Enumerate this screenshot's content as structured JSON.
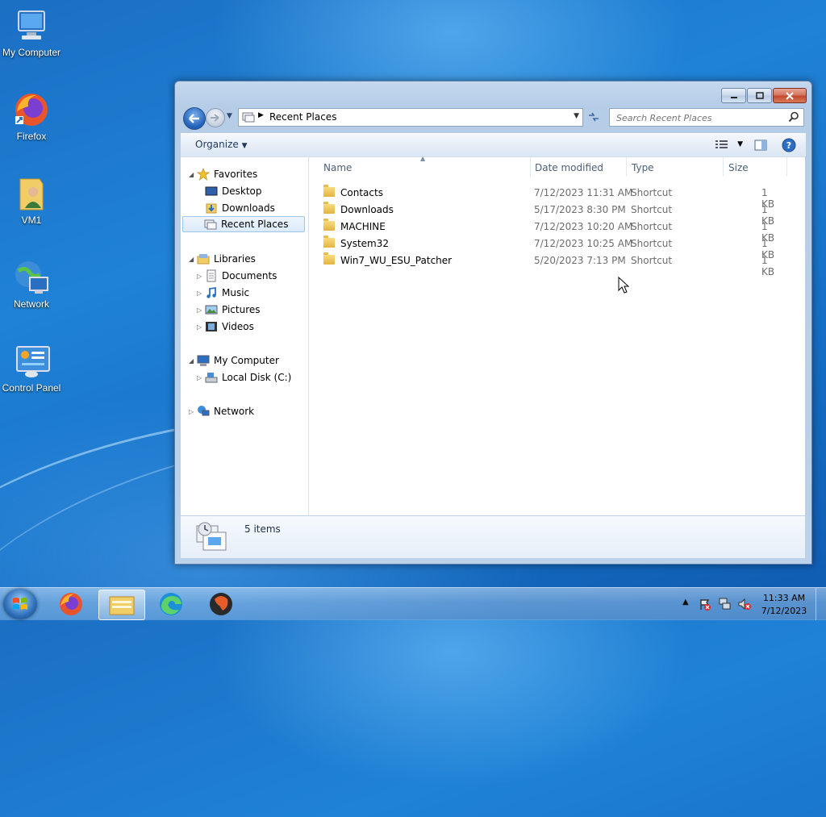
{
  "desktop": {
    "icons": [
      {
        "label": "My Computer",
        "icon": "computer-icon"
      },
      {
        "label": "Firefox",
        "icon": "firefox-icon"
      },
      {
        "label": "VM1",
        "icon": "user-folder-icon"
      },
      {
        "label": "Network",
        "icon": "network-icon"
      },
      {
        "label": "Control Panel",
        "icon": "control-panel-icon"
      }
    ]
  },
  "window": {
    "address": {
      "crumb": "Recent Places"
    },
    "search": {
      "placeholder": "Search Recent Places"
    },
    "toolbar": {
      "organize": "Organize"
    },
    "nav": {
      "favorites": "Favorites",
      "desktop": "Desktop",
      "downloads": "Downloads",
      "recent_places": "Recent Places",
      "libraries": "Libraries",
      "documents": "Documents",
      "music": "Music",
      "pictures": "Pictures",
      "videos": "Videos",
      "my_computer": "My Computer",
      "local_disk": "Local Disk (C:)",
      "network": "Network"
    },
    "columns": {
      "name": "Name",
      "date": "Date modified",
      "type": "Type",
      "size": "Size"
    },
    "files": [
      {
        "name": "Contacts",
        "date": "7/12/2023 11:31 AM",
        "type": "Shortcut",
        "size": "1 KB"
      },
      {
        "name": "Downloads",
        "date": "5/17/2023 8:30 PM",
        "type": "Shortcut",
        "size": "1 KB"
      },
      {
        "name": "MACHINE",
        "date": "7/12/2023 10:20 AM",
        "type": "Shortcut",
        "size": "1 KB"
      },
      {
        "name": "System32",
        "date": "7/12/2023 10:25 AM",
        "type": "Shortcut",
        "size": "1 KB"
      },
      {
        "name": "Win7_WU_ESU_Patcher",
        "date": "5/20/2023 7:13 PM",
        "type": "Shortcut",
        "size": "1 KB"
      }
    ],
    "details": {
      "count": "5 items"
    }
  },
  "taskbar": {
    "clock_time": "11:33 AM",
    "clock_date": "7/12/2023"
  },
  "colors": {
    "accent": "#1f82d6",
    "selection": "#dcebfc"
  }
}
